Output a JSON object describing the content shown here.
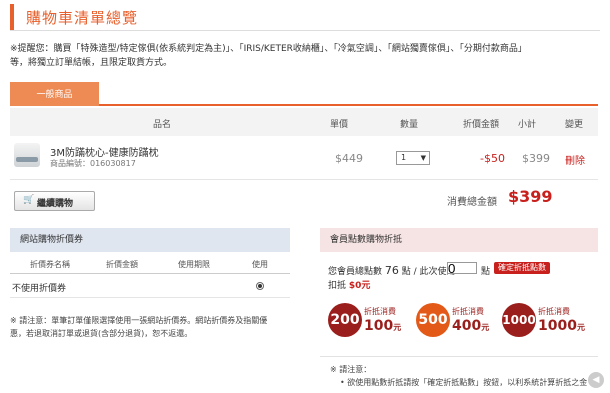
{
  "page": {
    "title": "購物車清單總覽"
  },
  "notice": {
    "line1": "※提醒您：購買「特殊造型/特定傢俱(依系統判定為主)」、「IRIS/KETER收納櫃」、「冷氣空調」、「網站獨賣傢俱」、「分期付款商品」",
    "line2": "等，將獨立訂單結帳，且限定取貨方式。"
  },
  "tabs": [
    {
      "label": "一般商品"
    }
  ],
  "table": {
    "headers": {
      "name": "品名",
      "price": "單價",
      "qty": "數量",
      "discount": "折價金額",
      "subtotal": "小計",
      "change": "變更"
    },
    "rows": [
      {
        "name": "3M防蹣枕心-健康防蹣枕",
        "code_label": "商品編號：",
        "code": "016030817",
        "price": "$449",
        "qty": "1",
        "discount": "-$50",
        "subtotal": "$399",
        "action": "刪除"
      }
    ]
  },
  "actions": {
    "continue_label": "繼續購物",
    "continue_icon": "cart-icon"
  },
  "totals": {
    "label": "消費總金額",
    "value": "$399"
  },
  "coupon": {
    "title": "網站購物折價券",
    "headers": {
      "name": "折價券名稱",
      "amount": "折價金額",
      "period": "使用期限",
      "use": "使用"
    },
    "rows": [
      {
        "name": "不使用折價券",
        "selected": true
      }
    ],
    "note1": "※ 請注意：單筆訂單僅限選擇使用一張網站折價券。網站折價券及指關優",
    "note2": "惠，若退取消訂單或退貨(含部分退貨)，恕不返還。"
  },
  "points": {
    "title": "會員點數購物折抵",
    "available_label": "您會員總點數",
    "available_value": "76",
    "available_unit": "點 / 此次使用",
    "use_unit": "點",
    "input_value": "0",
    "confirm_label": "確定折抵點數",
    "deduct_label": "扣抵",
    "deduct_value": "$0元",
    "tiers": [
      {
        "points": "200",
        "unit": "點",
        "line1": "折抵消費",
        "amount": "100",
        "suffix": "元"
      },
      {
        "points": "500",
        "unit": "點",
        "line1": "折抵消費",
        "amount": "400",
        "suffix": "元"
      },
      {
        "points": "1000",
        "unit": "點",
        "line1": "折抵消費",
        "amount": "1000",
        "suffix": "元"
      }
    ],
    "note_title": "※ 請注意：",
    "note_line": "• 欲使用點數折抵請按「確定折抵點數」按鈕，以利系統計算折抵之金"
  },
  "colors": {
    "accent": "#e8602c",
    "red": "#c8201c",
    "coupon_head": "#dfe6f0",
    "points_head": "#f6e3e3"
  }
}
